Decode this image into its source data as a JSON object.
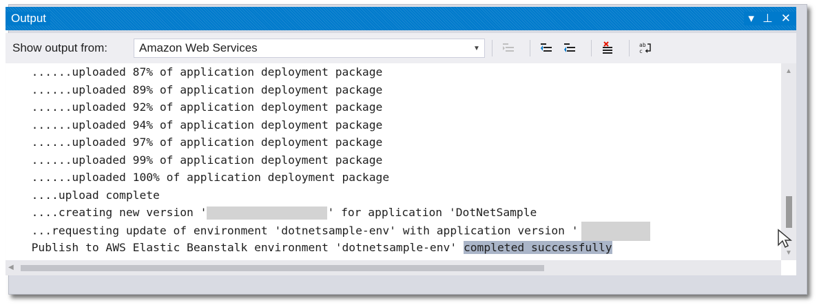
{
  "window": {
    "title": "Output",
    "controls": {
      "dropdown": "▾",
      "pin": "⊥",
      "close": "✕"
    }
  },
  "toolbar": {
    "show_output_label": "Show output from:",
    "source_value": "Amazon Web Services",
    "buttons": [
      "find-message-in-code-icon",
      "go-to-previous-message-icon",
      "go-to-next-message-icon",
      "clear-all-icon",
      "toggle-word-wrap-icon"
    ]
  },
  "output": {
    "lines": [
      "  ......uploaded 87% of application deployment package",
      "  ......uploaded 89% of application deployment package",
      "  ......uploaded 92% of application deployment package",
      "  ......uploaded 94% of application deployment package",
      "  ......uploaded 97% of application deployment package",
      "  ......uploaded 99% of application deployment package",
      "  ......uploaded 100% of application deployment package",
      "  ....upload complete"
    ],
    "creating_prefix": "  ....creating new version '",
    "creating_suffix": "' for application 'DotNetSample",
    "requesting_prefix": "  ...requesting update of environment 'dotnetsample-env' with application version '",
    "publish_prefix": "  Publish to AWS Elastic Beanstalk environment 'dotnetsample-env' ",
    "publish_highlight": "completed successfully"
  },
  "colors": {
    "titlebar": "#007acc",
    "selection": "#aab5c8",
    "redaction": "#d3d3d3"
  }
}
